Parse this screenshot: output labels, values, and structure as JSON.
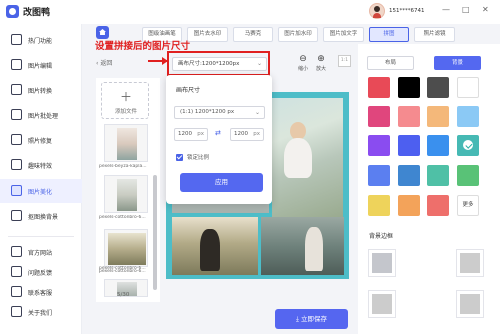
{
  "app": {
    "title": "改图鸭"
  },
  "user": {
    "phone": "151****6741"
  },
  "window": {
    "minimize": "—",
    "maximize": "□",
    "close": "✕"
  },
  "sidebar": {
    "items": [
      {
        "label": "热门功能",
        "active": false
      },
      {
        "label": "图片编辑",
        "active": false
      },
      {
        "label": "图片转换",
        "active": false
      },
      {
        "label": "图片批处理",
        "active": false
      },
      {
        "label": "照片修复",
        "active": false
      },
      {
        "label": "趣味特效",
        "active": false
      },
      {
        "label": "图片美化",
        "active": true
      },
      {
        "label": "抠图换背景",
        "active": false
      }
    ],
    "footer": [
      {
        "label": "官方网站"
      },
      {
        "label": "问题反馈"
      },
      {
        "label": "联系客服"
      },
      {
        "label": "关于我们"
      }
    ]
  },
  "tabs": [
    {
      "label": "图级油画笔",
      "active": false
    },
    {
      "label": "图片去水印",
      "active": false
    },
    {
      "label": "马赛克",
      "active": false
    },
    {
      "label": "图片加水印",
      "active": false
    },
    {
      "label": "图片加文字",
      "active": false
    },
    {
      "label": "拼图",
      "active": true
    },
    {
      "label": "照片滤镜",
      "active": false
    }
  ],
  "toolbar": {
    "back_label": "返回",
    "size_dropdown": "画布尺寸:1200*1200px",
    "zoom_out_label": "缩小",
    "zoom_in_label": "放大",
    "ratio_label": "1:1"
  },
  "annotation": {
    "text": "设置拼接后的图片尺寸"
  },
  "file_panel": {
    "add_label": "添加文件",
    "files": [
      {
        "name": "pexels-beyza-kapla..."
      },
      {
        "name": "pexels-cottonbro-6..."
      },
      {
        "name": "pexels-cottonbro-6..."
      },
      {
        "name": "pexels-cottonbro-6..."
      }
    ],
    "page_count": "5/30"
  },
  "popup": {
    "title": "画布尺寸",
    "ratio_select": "(1:1) 1200*1200 px",
    "width": "1200",
    "height": "1200",
    "unit": "px",
    "lock_label": "锁定比例",
    "apply_label": "应用"
  },
  "save_button": {
    "label": "立即保存"
  },
  "right_panel": {
    "tab_layout": "布局",
    "tab_background": "背景",
    "swatches": [
      "#e84a57",
      "#000000",
      "#4d4d4d",
      "#ffffff",
      "#e0467d",
      "#f58b8f",
      "#f4b87a",
      "#8bc9f5",
      "#8a4cf0",
      "#4d5ff0",
      "#3a90ee",
      "#46b9b4",
      "#5b7ff0",
      "#3f86d0",
      "#4fc0a6",
      "#59c277",
      "#eed35b",
      "#f3a35a",
      "#ee6f6b"
    ],
    "selected_swatch": "#46b9b4",
    "more_label": "更多",
    "border_title": "背景边框"
  }
}
